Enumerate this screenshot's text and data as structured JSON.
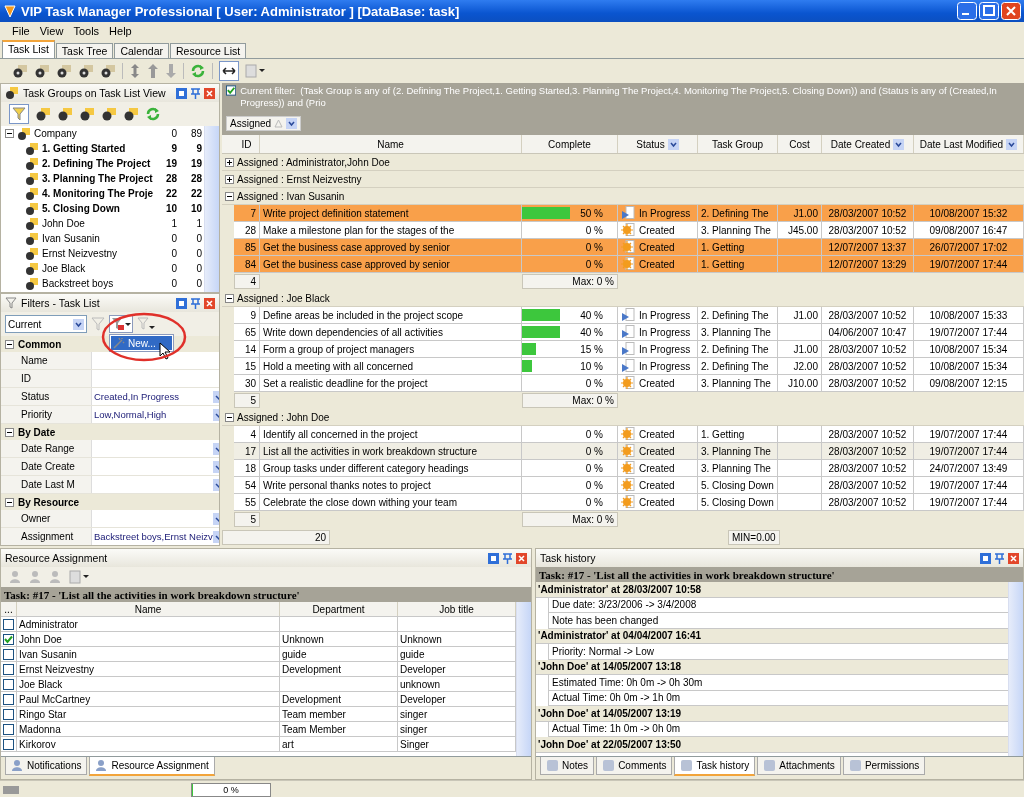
{
  "window": {
    "title": "VIP Task Manager Professional [ User: Administrator ] [DataBase: task]"
  },
  "menu": [
    "File",
    "View",
    "Tools",
    "Help"
  ],
  "tabs": [
    {
      "label": "Task List",
      "selected": true
    },
    {
      "label": "Task Tree",
      "selected": false
    },
    {
      "label": "Calendar",
      "selected": false
    },
    {
      "label": "Resource List",
      "selected": false
    }
  ],
  "task_groups_panel": {
    "title": "Task Groups on Task List View",
    "tree": {
      "label": "Company",
      "count_1": "0",
      "count_2": "89",
      "expanded": true,
      "children": [
        {
          "label": "1. Getting Started",
          "kind": "group",
          "count_1": "9",
          "count_2": "9"
        },
        {
          "label": "2. Defining The Project",
          "kind": "group",
          "count_1": "19",
          "count_2": "19"
        },
        {
          "label": "3. Planning The Project",
          "kind": "group",
          "count_1": "28",
          "count_2": "28"
        },
        {
          "label": "4. Monitoring The Proje",
          "kind": "group",
          "count_1": "22",
          "count_2": "22"
        },
        {
          "label": "5. Closing Down",
          "kind": "group",
          "count_1": "10",
          "count_2": "10"
        },
        {
          "label": "John Doe",
          "kind": "resource",
          "count_1": "1",
          "count_2": "1"
        },
        {
          "label": "Ivan Susanin",
          "kind": "resource",
          "count_1": "0",
          "count_2": "0"
        },
        {
          "label": "Ernst Neizvestny",
          "kind": "resource",
          "count_1": "0",
          "count_2": "0"
        },
        {
          "label": "Joe Black",
          "kind": "resource",
          "count_1": "0",
          "count_2": "0"
        },
        {
          "label": "Backstreet boys",
          "kind": "resource",
          "count_1": "0",
          "count_2": "0"
        }
      ]
    }
  },
  "filters_panel": {
    "title": "Filters - Task List",
    "filter_select": "Current",
    "menu": {
      "items": [
        "New..."
      ]
    },
    "sections": [
      {
        "label": "Common",
        "expanded": true,
        "rows": [
          {
            "label": "Name",
            "dropdown": false
          },
          {
            "label": "ID",
            "dropdown": false
          },
          {
            "label": "Status",
            "value": "Created,In Progress",
            "dropdown": true
          },
          {
            "label": "Priority",
            "value": "Low,Normal,High",
            "dropdown": true
          }
        ]
      },
      {
        "label": "By Date",
        "expanded": true,
        "rows": [
          {
            "label": "Date Range",
            "dropdown": true
          },
          {
            "label": "Date Create",
            "dropdown": true
          },
          {
            "label": "Date Last M",
            "dropdown": true
          }
        ]
      },
      {
        "label": "By Resource",
        "expanded": true,
        "rows": [
          {
            "label": "Owner",
            "dropdown": true
          },
          {
            "label": "Assignment",
            "value": "Backstreet boys,Ernst Neizv",
            "dropdown": true
          }
        ]
      }
    ]
  },
  "task_table": {
    "filter": {
      "enabled": true,
      "label": "Current filter:",
      "text": "(Task Group is any of (2. Defining The Project,1. Getting Started,3. Planning The Project,4. Monitoring The Project,5. Closing Down)) and (Status is any of (Created,In Progress)) and (Prio"
    },
    "group_by": "Assigned",
    "columns": [
      {
        "label": "ID",
        "filter": false
      },
      {
        "label": "Name",
        "filter": false
      },
      {
        "label": "Complete",
        "filter": false
      },
      {
        "label": "Status",
        "filter": true
      },
      {
        "label": "Task Group",
        "filter": false
      },
      {
        "label": "Cost",
        "filter": false
      },
      {
        "label": "Date Created",
        "filter": true
      },
      {
        "label": "Date Last Modified",
        "filter": true
      }
    ],
    "groups": [
      {
        "label": "Assigned : Administrator,John Doe",
        "expanded": false
      },
      {
        "label": "Assigned : Ernst Neizvestny",
        "expanded": false
      },
      {
        "label": "Assigned : Ivan Susanin",
        "expanded": true,
        "rows": [
          {
            "id": "7",
            "name": "Write project definition statement",
            "level": 0.5,
            "complete": "50 %",
            "kind": "in_progress",
            "status": "In Progress",
            "task_group": "2. Defining The",
            "cost": "J1.00",
            "date_created": "28/03/2007 10:52",
            "date_modified": "10/08/2007 15:32",
            "highlighted": true,
            "selected": false
          },
          {
            "id": "28",
            "name": "Make a milestone plan for the stages of the",
            "level": 0,
            "complete": "0 %",
            "kind": "created",
            "status": "Created",
            "task_group": "3. Planning The",
            "cost": "J45.00",
            "date_created": "28/03/2007 10:52",
            "date_modified": "09/08/2007 16:47",
            "highlighted": false,
            "selected": false
          },
          {
            "id": "85",
            "name": "Get the business case approved by senior",
            "level": 0,
            "complete": "0 %",
            "kind": "created",
            "status": "Created",
            "task_group": "1. Getting",
            "date_created": "12/07/2007 13:37",
            "date_modified": "26/07/2007 17:02",
            "highlighted": true,
            "selected": false
          },
          {
            "id": "84",
            "name": "Get the business case approved by senior",
            "level": 0,
            "complete": "0 %",
            "kind": "created",
            "status": "Created",
            "task_group": "1. Getting",
            "date_created": "12/07/2007 13:29",
            "date_modified": "19/07/2007 17:44",
            "highlighted": true,
            "selected": false
          }
        ],
        "footer": {
          "count": "4",
          "summary": "Max: 0 %"
        }
      },
      {
        "label": "Assigned : Joe Black",
        "expanded": true,
        "rows": [
          {
            "id": "9",
            "name": "Define areas be included in the project scope",
            "level": 0.4,
            "complete": "40 %",
            "kind": "in_progress",
            "status": "In Progress",
            "task_group": "2. Defining The",
            "cost": "J1.00",
            "date_created": "28/03/2007 10:52",
            "date_modified": "10/08/2007 15:33",
            "highlighted": false,
            "selected": false
          },
          {
            "id": "65",
            "name": "Write down dependencies of all activities",
            "level": 0.4,
            "complete": "40 %",
            "kind": "in_progress",
            "status": "In Progress",
            "task_group": "3. Planning The",
            "date_created": "04/06/2007 10:47",
            "date_modified": "19/07/2007 17:44",
            "highlighted": false,
            "selected": false
          },
          {
            "id": "14",
            "name": "Form a group of project managers",
            "level": 0.15,
            "complete": "15 %",
            "kind": "in_progress",
            "status": "In Progress",
            "task_group": "2. Defining The",
            "cost": "J1.00",
            "date_created": "28/03/2007 10:52",
            "date_modified": "10/08/2007 15:34",
            "highlighted": false,
            "selected": false
          },
          {
            "id": "15",
            "name": "Hold a meeting with all concerned",
            "level": 0.1,
            "complete": "10 %",
            "kind": "in_progress",
            "status": "In Progress",
            "task_group": "2. Defining The",
            "cost": "J2.00",
            "date_created": "28/03/2007 10:52",
            "date_modified": "10/08/2007 15:34",
            "highlighted": false,
            "selected": false
          },
          {
            "id": "30",
            "name": "Set a realistic deadline for the project",
            "level": 0,
            "complete": "0 %",
            "kind": "created",
            "status": "Created",
            "task_group": "3. Planning The",
            "cost": "J10.00",
            "date_created": "28/03/2007 10:52",
            "date_modified": "09/08/2007 12:15",
            "highlighted": false,
            "selected": false
          }
        ],
        "footer": {
          "count": "5",
          "summary": "Max: 0 %"
        }
      },
      {
        "label": "Assigned : John Doe",
        "expanded": true,
        "rows": [
          {
            "id": "4",
            "name": "Identify all concerned in the project",
            "level": 0,
            "complete": "0 %",
            "kind": "created",
            "status": "Created",
            "task_group": "1. Getting",
            "date_created": "28/03/2007 10:52",
            "date_modified": "19/07/2007 17:44",
            "highlighted": false,
            "selected": false
          },
          {
            "id": "17",
            "name": "List all the activities in work breakdown structure",
            "level": 0,
            "complete": "0 %",
            "kind": "created",
            "status": "Created",
            "task_group": "3. Planning The",
            "date_created": "28/03/2007 10:52",
            "date_modified": "19/07/2007 17:44",
            "highlighted": false,
            "selected": true
          },
          {
            "id": "18",
            "name": "Group tasks under different category headings",
            "level": 0,
            "complete": "0 %",
            "kind": "created",
            "status": "Created",
            "task_group": "3. Planning The",
            "date_created": "28/03/2007 10:52",
            "date_modified": "24/07/2007 13:49",
            "highlighted": false,
            "selected": false
          },
          {
            "id": "54",
            "name": "Write personal thanks notes to project",
            "level": 0,
            "complete": "0 %",
            "kind": "created",
            "status": "Created",
            "task_group": "5. Closing Down",
            "date_created": "28/03/2007 10:52",
            "date_modified": "19/07/2007 17:44",
            "highlighted": false,
            "selected": false
          },
          {
            "id": "55",
            "name": "Celebrate the close down withing your team",
            "level": 0,
            "complete": "0 %",
            "kind": "created",
            "status": "Created",
            "task_group": "5. Closing Down",
            "date_created": "28/03/2007 10:52",
            "date_modified": "19/07/2007 17:44",
            "highlighted": false,
            "selected": false
          }
        ],
        "footer": {
          "count": "5",
          "summary": "Max: 0 %"
        }
      }
    ],
    "total": {
      "count": "20",
      "summary": "MIN=0.00"
    }
  },
  "resource_panel": {
    "title": "Resource Assignment",
    "task": "Task: #17 - 'List all the activities in work breakdown structure'",
    "columns": [
      "...",
      "Name",
      "Department",
      "Job title"
    ],
    "rows": [
      {
        "checked": false,
        "name": "Administrator"
      },
      {
        "checked": true,
        "name": "John Doe",
        "department": "Unknown",
        "job_title": "Unknown"
      },
      {
        "checked": false,
        "name": "Ivan Susanin",
        "department": "guide",
        "job_title": "guide"
      },
      {
        "checked": false,
        "name": "Ernst Neizvestny",
        "department": "Development",
        "job_title": "Developer"
      },
      {
        "checked": false,
        "name": "Joe Black",
        "job_title": "unknown"
      },
      {
        "checked": false,
        "name": "Paul McCartney",
        "department": "Development",
        "job_title": "Developer"
      },
      {
        "checked": false,
        "name": "Ringo Star",
        "department": "Team member",
        "job_title": "singer"
      },
      {
        "checked": false,
        "name": "Madonna",
        "department": "Team Member",
        "job_title": "singer"
      },
      {
        "checked": false,
        "name": "Kirkorov",
        "department": "art",
        "job_title": "Singer"
      }
    ],
    "tabs": [
      {
        "label": "Notifications",
        "selected": false
      },
      {
        "label": "Resource Assignment",
        "selected": true
      }
    ]
  },
  "history_panel": {
    "title": "Task history",
    "task": "Task: #17 - 'List all the activities in work breakdown structure'",
    "entries": [
      {
        "header": "'Administrator' at 28/03/2007 10:58",
        "changes": [
          "Due date: 3/23/2006 -> 3/4/2008",
          "Note has been changed"
        ]
      },
      {
        "header": "'Administrator' at 04/04/2007 16:41",
        "changes": [
          "Priority: Normal -> Low"
        ]
      },
      {
        "header": "'John Doe' at 14/05/2007 13:18",
        "changes": [
          "Estimated Time: 0h 0m -> 0h 30m",
          "Actual Time: 0h 0m -> 1h 0m"
        ]
      },
      {
        "header": "'John Doe' at 14/05/2007 13:19",
        "changes": [
          "Actual Time: 1h 0m -> 0h 0m"
        ]
      },
      {
        "header": "'John Doe' at 22/05/2007 13:50"
      }
    ],
    "tabs": [
      {
        "label": "Notes",
        "selected": false
      },
      {
        "label": "Comments",
        "selected": false
      },
      {
        "label": "Task history",
        "selected": true
      },
      {
        "label": "Attachments",
        "selected": false
      },
      {
        "label": "Permissions",
        "selected": false
      }
    ]
  },
  "status_bar": {
    "progress": {
      "level": 0,
      "text": "0 %"
    }
  }
}
